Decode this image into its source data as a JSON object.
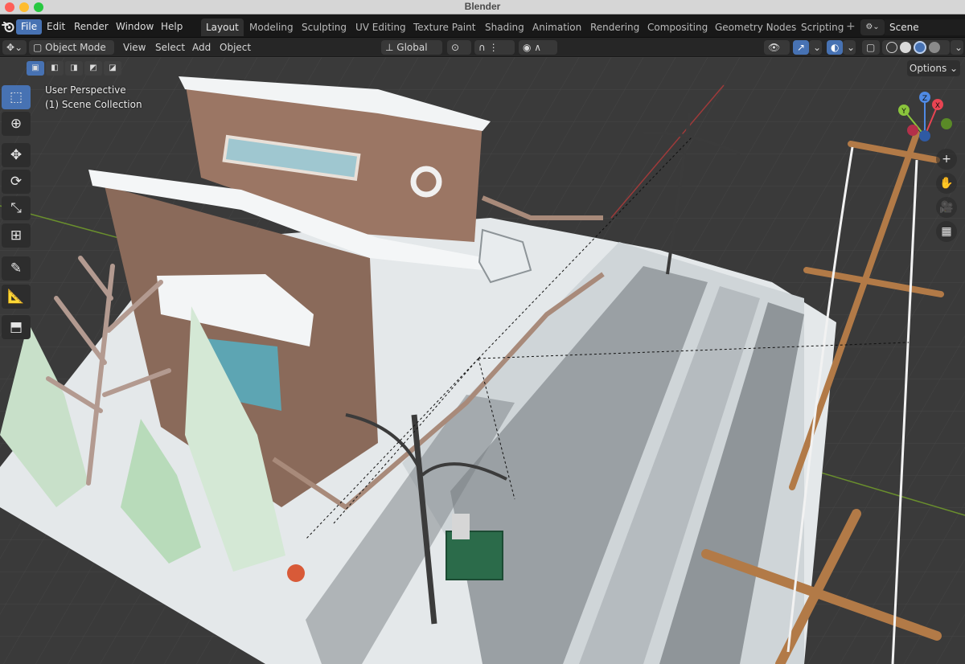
{
  "window": {
    "title": "Blender"
  },
  "menu": [
    "File",
    "Edit",
    "Render",
    "Window",
    "Help"
  ],
  "workspaces": [
    "Layout",
    "Modeling",
    "Sculpting",
    "UV Editing",
    "Texture Paint",
    "Shading",
    "Animation",
    "Rendering",
    "Compositing",
    "Geometry Nodes",
    "Scripting"
  ],
  "active_workspace": "Layout",
  "scene": {
    "name": "Scene"
  },
  "viewport_header": {
    "mode": "Object Mode",
    "menus": [
      "View",
      "Select",
      "Add",
      "Object"
    ],
    "transform_orientation": "Global"
  },
  "viewport": {
    "view_name": "User Perspective",
    "collection": "(1) Scene Collection",
    "options_label": "Options",
    "gizmo_axes": [
      "X",
      "Y",
      "Z"
    ]
  },
  "tools": [
    "select-box",
    "cursor",
    "move",
    "rotate",
    "scale",
    "transform",
    "annotate",
    "measure",
    "add-cube"
  ],
  "icons": {
    "chevron": "⌄",
    "plus": "+",
    "hand": "✋",
    "camera": "🎥",
    "grid": "▦"
  },
  "colors": {
    "accent": "#4772b3",
    "axis_x": "#e84452",
    "axis_y": "#8ac43c",
    "axis_z": "#4f8ae4"
  }
}
